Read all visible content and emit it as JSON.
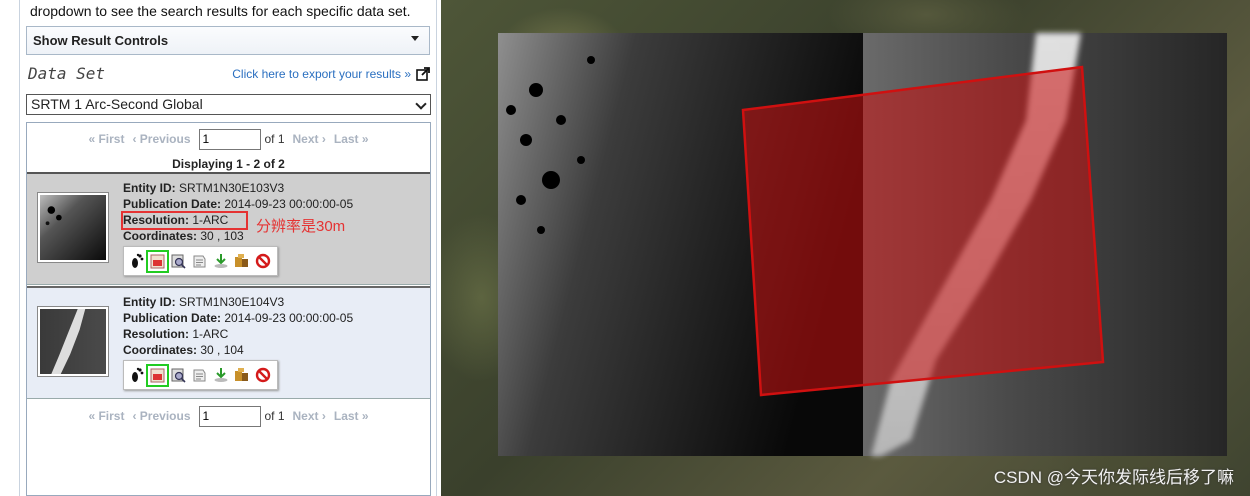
{
  "intro_text": "dropdown to see the search results for each specific data set.",
  "result_controls": {
    "label": "Show Result Controls"
  },
  "dataset": {
    "title": "Data Set",
    "export_link": "Click here to export your results »",
    "selected": "SRTM 1 Arc-Second Global"
  },
  "pagination": {
    "first": "« First",
    "previous": "‹ Previous",
    "page_value": "1",
    "of_text": "of 1",
    "next": "Next ›",
    "last": "Last »"
  },
  "displaying": "Displaying 1 - 2 of 2",
  "labels": {
    "entity_id": "Entity ID:",
    "publication_date": "Publication Date:",
    "resolution": "Resolution:",
    "coordinates": "Coordinates:"
  },
  "results": [
    {
      "entity_id": "SRTM1N30E103V3",
      "publication_date": "2014-09-23 00:00:00-05",
      "resolution": "1-ARC",
      "coordinates": "30 , 103"
    },
    {
      "entity_id": "SRTM1N30E104V3",
      "publication_date": "2014-09-23 00:00:00-05",
      "resolution": "1-ARC",
      "coordinates": "30 , 104"
    }
  ],
  "annotation": "分辨率是30m",
  "watermark": "CSDN @今天你发际线后移了嘛",
  "colors": {
    "highlight_red": "#e53333",
    "footprint_red": "#cc1111",
    "link_blue": "#2a6fc0"
  }
}
